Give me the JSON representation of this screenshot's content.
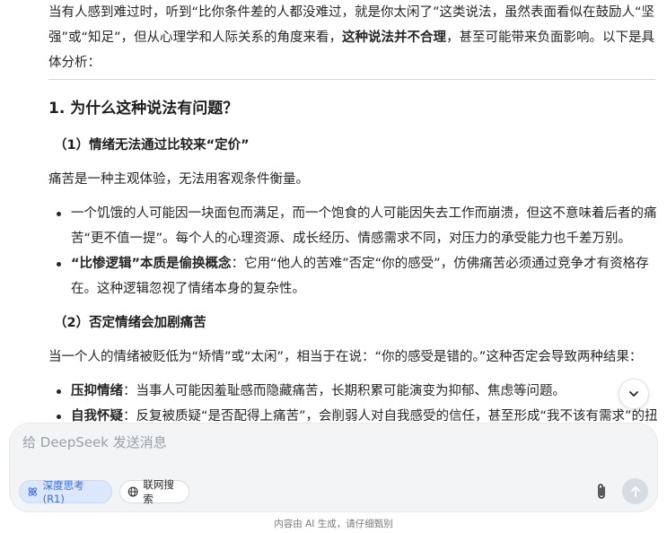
{
  "message": {
    "intro": {
      "part1": "当有人感到难过时，听到“比你条件差的人都没难过，就是你太闲了”这类说法，虽然表面看似在鼓励人“坚强”或“知足”，但从心理学和人际关系的角度来看，",
      "bold": "这种说法并不合理",
      "part2": "，甚至可能带来负面影响。以下是具体分析："
    },
    "section1_title": "1. 为什么这种说法有问题？",
    "sub1_title": "（1）情绪无法通过比较来“定价”",
    "sub1_text": "痛苦是一种主观体验，无法用客观条件衡量。",
    "sub1_bullets": [
      {
        "bold": "",
        "text": "一个饥饿的人可能因一块面包而满足，而一个饱食的人可能因失去工作而崩溃，但这不意味着后者的痛苦“更不值一提”。每个人的心理资源、成长经历、情感需求不同，对压力的承受能力也千差万别。"
      },
      {
        "bold": "“比惨逻辑”本质是偷换概念",
        "text": "：它用“他人的苦难”否定“你的感受”，仿佛痛苦必须通过竞争才有资格存在。这种逻辑忽视了情绪本身的复杂性。"
      }
    ],
    "sub2_title": "（2）否定情绪会加剧痛苦",
    "sub2_text": "当一个人的情绪被贬低为“矫情”或“太闲”，相当于在说：“你的感受是错的。”这种否定会导致两种结果：",
    "sub2_bullets": [
      {
        "bold": "压抑情绪",
        "text": "：当事人可能因羞耻感而隐藏痛苦，长期积累可能演变为抑郁、焦虑等问题。"
      },
      {
        "bold": "自我怀疑",
        "text": "：反复被质疑“是否配得上痛苦”，会削弱人对自我感受的信任，甚至形成“我不该有需求”的扭"
      }
    ]
  },
  "composer": {
    "placeholder": "给 DeepSeek 发送消息",
    "deep_think_label": "深度思考 (R1)",
    "web_search_label": "联网搜索"
  },
  "footer": {
    "disclaimer": "内容由 AI 生成，请仔细甄别"
  },
  "colors": {
    "accent": "#3b6ce0",
    "pill_active_bg": "#dbe7fd",
    "send_disabled": "#d6dbe4"
  }
}
